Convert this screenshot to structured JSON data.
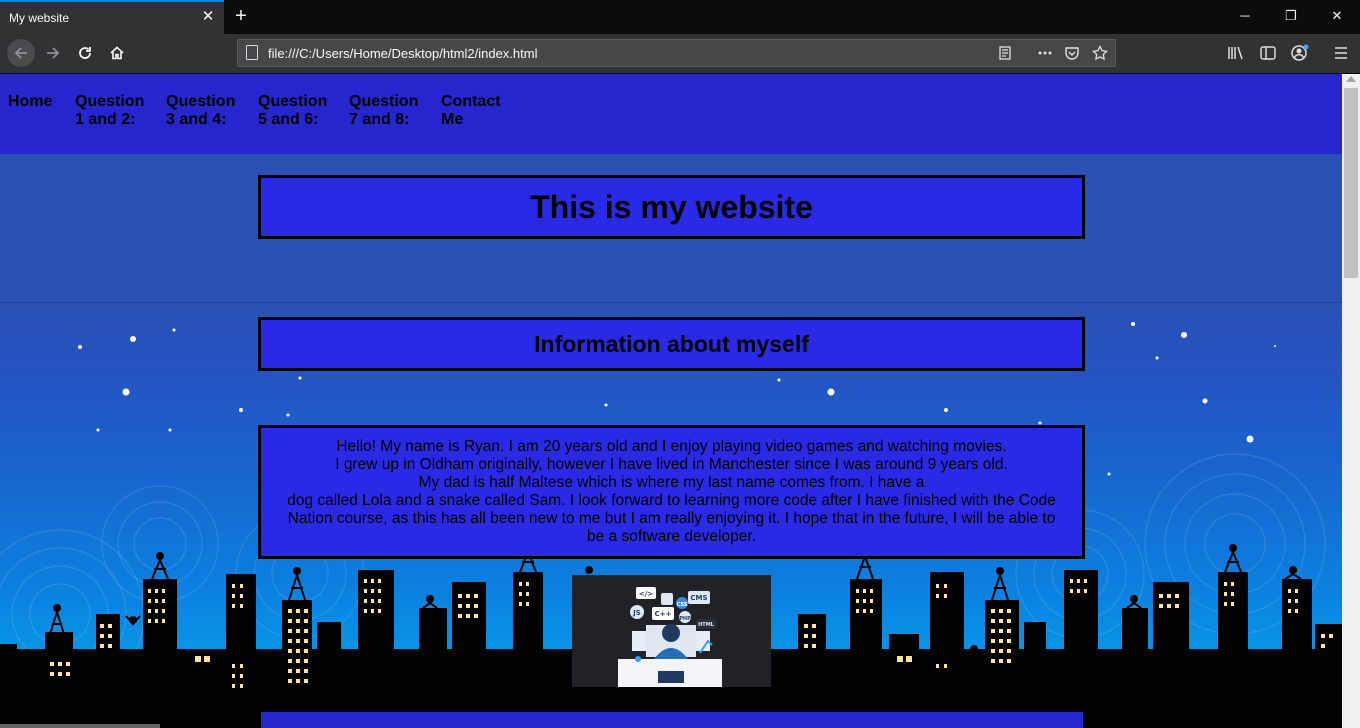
{
  "browser": {
    "tab_title": "My website",
    "tab_close": "✕",
    "new_tab": "+",
    "url": "file:///C:/Users/Home/Desktop/html2/index.html",
    "window_controls": {
      "minimize": "─",
      "restore": "❐",
      "close": "✕"
    },
    "icons": [
      "back-arrow-icon",
      "forward-arrow-icon",
      "reload-icon",
      "home-icon",
      "page-icon",
      "reader-view-icon",
      "more-actions-icon",
      "pocket-icon",
      "bookmark-star-icon",
      "library-icon",
      "sidebar-icon",
      "account-icon",
      "menu-icon"
    ]
  },
  "site": {
    "nav": [
      {
        "label": "Home"
      },
      {
        "label": "Question\n1 and 2:"
      },
      {
        "label": "Question\n3 and 4:"
      },
      {
        "label": "Question\n5 and 6:"
      },
      {
        "label": "Question\n7 and 8:"
      },
      {
        "label": "Contact\nMe"
      }
    ],
    "title": "This is my website",
    "section_heading": "Information about myself",
    "bio_lines": [
      "Hello! My name is Ryan. I am 20 years old and I enjoy playing video games and watching movies.",
      "I grew up in Oldham originally, however I have lived in Manchester since I was around 9 years old.",
      "My dad is half Maltese which is where my last name comes from. I have a",
      "dog called Lola and a snake called Sam. I look forward to learning more code after I have finished with the Code Nation course, as this has all been new to me but I am really enjoying it. I hope that in the future, I will be able to be a software developer."
    ],
    "image_labels": [
      "</>",
      "CMS",
      "JS",
      "C++",
      "CSS",
      "PHP",
      "HTML"
    ]
  },
  "colors": {
    "nav_bg": "#2626cf",
    "box_bg": "#2a2ae6",
    "accent": "#0a84ff"
  }
}
